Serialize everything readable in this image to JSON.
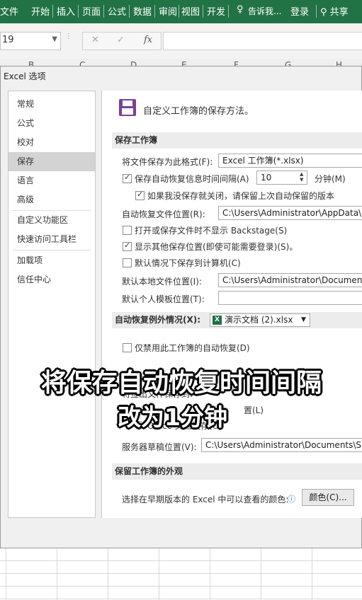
{
  "ribbon": {
    "tabs": [
      "文件",
      "开始",
      "插入",
      "页面",
      "公式",
      "数据",
      "审阅",
      "视图",
      "开发"
    ],
    "tell_me": "告诉我...",
    "login": "登录",
    "share": "共享"
  },
  "formula_bar": {
    "name_box": "19",
    "cancel": "✕",
    "confirm": "✓",
    "fx": "fx"
  },
  "columns": [
    "B",
    "C",
    "D",
    "E",
    "F",
    "G",
    "H"
  ],
  "dialog": {
    "title": "Excel 选项",
    "nav": [
      "常规",
      "公式",
      "校对",
      "保存",
      "语言",
      "高级",
      "自定义功能区",
      "快速访问工具栏",
      "加载项",
      "信任中心"
    ],
    "selected_nav": "保存",
    "header": "自定义工作簿的保存方法。",
    "save_section": "保存工作簿",
    "format_label": "将文件保存为此格式(F):",
    "format_value": "Excel 工作簿(*.xlsx)",
    "autorecover_label": "保存自动恢复信息时间间隔(A)",
    "autorecover_value": "10",
    "minutes": "分钟(M)",
    "keep_last_label": "如果我没保存就关闭，请保留上次自动保留的版本",
    "autorecover_loc_label": "自动恢复文件位置(R):",
    "autorecover_loc_value": "C:\\Users\\Administrator\\AppData\\R",
    "backstage_label": "打开或保存文件时不显示 Backstage(S)",
    "show_more_label": "显示其他保存位置(即使可能需要登录)(S)。",
    "default_local_label": "默认情况下保存到计算机(C)",
    "default_loc_label": "默认本地文件位置(I):",
    "default_loc_value": "C:\\Users\\Administrator\\Documents",
    "template_label": "默认个人模板位置(T):",
    "template_value": "",
    "exceptions_label": "自动恢复例外情况(X):",
    "exceptions_file": "演示文档 (2).xlsx",
    "disable_label": "仅禁用此工作簿的自动恢复(D)",
    "offline_partial1": "将签出文件保存到:",
    "offline_partial2": "置(L)",
    "office_cache_label": "Office 文档缓存(O)",
    "server_label": "服务器草稿位置(V):",
    "server_value": "C:\\Users\\Administrator\\Documents\\Sha",
    "appearance_section": "保留工作簿的外观",
    "color_label": "选择在早期版本的 Excel 中可以查看的颜色:",
    "color_button": "颜色(C)..."
  },
  "caption": {
    "line1": "将保存自动恢复时间间隔",
    "line2": "改为1分钟"
  },
  "colors": {
    "ribbon": "#217346",
    "excel_icon": "#1e7145",
    "save_icon": "#7b3f9a"
  }
}
